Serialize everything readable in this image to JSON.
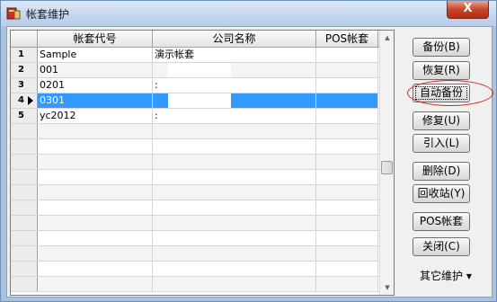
{
  "window": {
    "title": "帐套维护",
    "close_glyph": "X"
  },
  "grid": {
    "columns": [
      "",
      "帐套代号",
      "公司名称",
      "POS帐套"
    ],
    "rows": [
      {
        "num": "1",
        "code": "Sample",
        "company": "演示帐套",
        "pos": ""
      },
      {
        "num": "2",
        "code": "001",
        "company": "",
        "pos": ""
      },
      {
        "num": "3",
        "code": "0201",
        "company": ":",
        "pos": ""
      },
      {
        "num": "4",
        "code": "0301",
        "company": "",
        "pos": ""
      },
      {
        "num": "5",
        "code": "yc2012",
        "company": ":",
        "pos": ""
      },
      {
        "num": "",
        "code": "",
        "company": "",
        "pos": ""
      },
      {
        "num": "",
        "code": "",
        "company": "",
        "pos": ""
      },
      {
        "num": "",
        "code": "",
        "company": "",
        "pos": ""
      },
      {
        "num": "",
        "code": "",
        "company": "",
        "pos": ""
      },
      {
        "num": "",
        "code": "",
        "company": "",
        "pos": ""
      },
      {
        "num": "",
        "code": "",
        "company": "",
        "pos": ""
      },
      {
        "num": "",
        "code": "",
        "company": "",
        "pos": ""
      },
      {
        "num": "",
        "code": "",
        "company": "",
        "pos": ""
      },
      {
        "num": "",
        "code": "",
        "company": "",
        "pos": ""
      },
      {
        "num": "",
        "code": "",
        "company": "",
        "pos": ""
      },
      {
        "num": "",
        "code": "",
        "company": "",
        "pos": ""
      }
    ],
    "selected_row": 3
  },
  "buttons": {
    "backup": "备份(B)",
    "restore": "恢复(R)",
    "auto_backup": "自动备份",
    "repair": "修复(U)",
    "import": "引入(L)",
    "delete": "删除(D)",
    "recycle": "回收站(Y)",
    "pos_account": "POS帐套",
    "close": "关闭(C)",
    "other_menu": "其它维护 ▾"
  },
  "colors": {
    "selection": "#3399ff",
    "annotation_circle": "#d42020"
  }
}
